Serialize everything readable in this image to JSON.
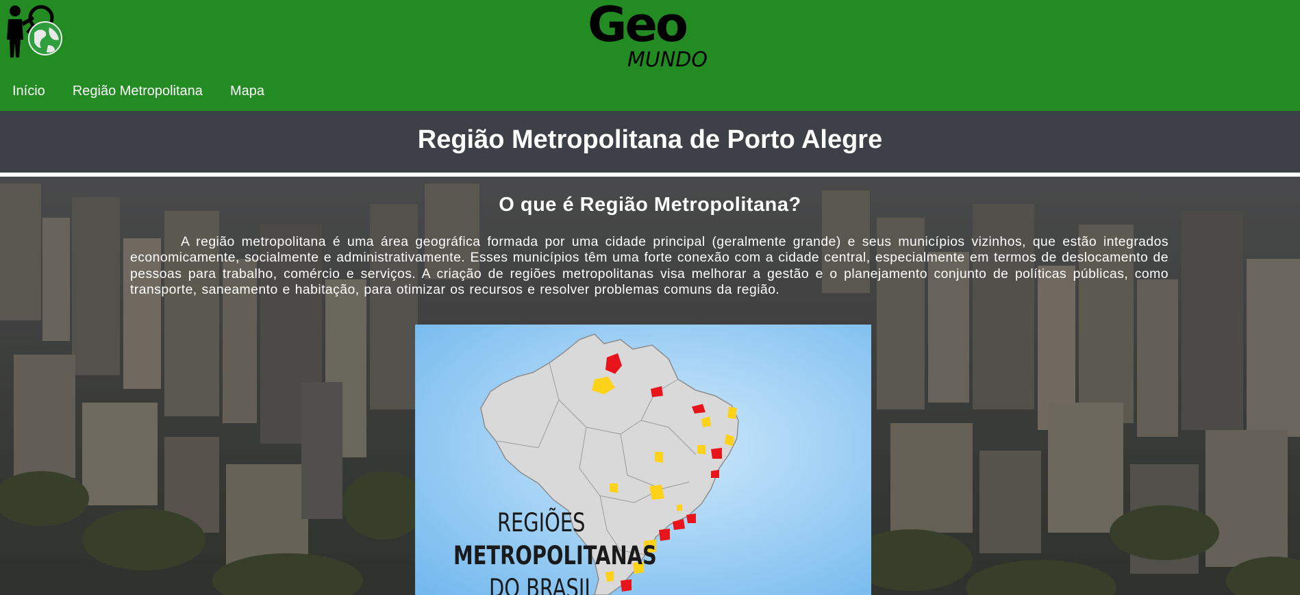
{
  "header": {
    "brand_main": "Geo",
    "brand_sub": "MUNDO",
    "nav": [
      {
        "label": "Início"
      },
      {
        "label": "Região Metropolitana"
      },
      {
        "label": "Mapa"
      }
    ],
    "bg_color": "#228b22"
  },
  "page": {
    "title": "Região Metropolitana de Porto Alegre"
  },
  "section": {
    "heading": "O que é Região Metropolitana?",
    "paragraph": "A região metropolitana é uma área geográfica formada por uma cidade principal (geralmente grande) e seus municípios vizinhos, que estão integrados economicamente, socialmente e administrativamente. Esses municípios têm uma forte conexão com a cidade central, especialmente em termos de deslocamento de pessoas para trabalho, comércio e serviços. A criação de regiões metropolitanas visa melhorar a gestão e o planejamento conjunto de políticas públicas, como transporte, saneamento e habitação, para otimizar os recursos e resolver problemas comuns da região."
  },
  "map_image": {
    "caption_line_1": "REGIÕES",
    "caption_line_2": "METROPOLITANAS",
    "caption_line_3": "DO BRASIL",
    "highlight_colors": [
      "#e8141b",
      "#ffd21a"
    ]
  }
}
